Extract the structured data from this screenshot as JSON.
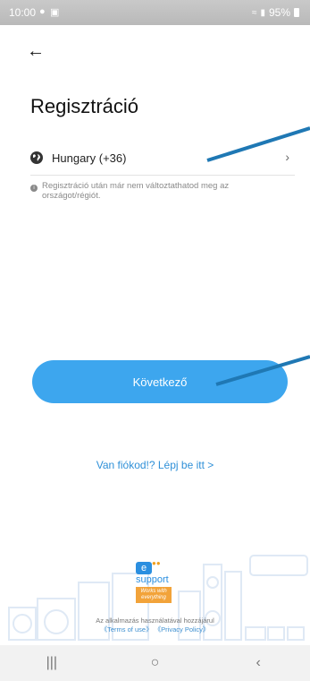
{
  "status_bar": {
    "time": "10:00",
    "battery": "95%"
  },
  "header": {
    "title": "Regisztráció"
  },
  "country": {
    "label": "Hungary (+36)"
  },
  "notice": "Regisztráció után már nem változtathatod meg az országot/régiót.",
  "next_button": "Következő",
  "login_link": "Van fiókod!? Lépj be itt",
  "login_chevron": ">",
  "logo": {
    "letter": "e",
    "word": "support",
    "tagline": "Works with everything"
  },
  "legal": {
    "text": "Az alkalmazás használatával hozzájárul",
    "terms": "《Terms of use》",
    "privacy": "《Privacy Policy》"
  },
  "colors": {
    "primary": "#3da6ee",
    "link": "#2f90d8",
    "annotation_line": "#1f78b4",
    "logo_orange": "#f2a33a"
  }
}
